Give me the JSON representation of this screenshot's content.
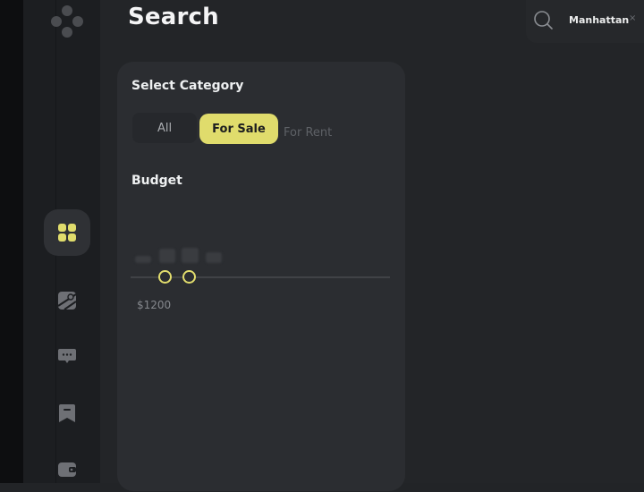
{
  "page": {
    "title": "Search"
  },
  "search": {
    "chip_label": "Manhattan",
    "chip_close": "×"
  },
  "filters": {
    "category_title": "Select Category",
    "categories": [
      "All",
      "For Sale",
      "For Rent"
    ],
    "selected_category": "For Sale",
    "budget_title": "Budget",
    "budget_min_label": "$1200"
  },
  "sidebar": {
    "items": [
      {
        "icon": "grid-icon",
        "active": true
      },
      {
        "icon": "map-icon",
        "active": false
      },
      {
        "icon": "chat-icon",
        "active": false
      },
      {
        "icon": "bookmark-icon",
        "active": false
      },
      {
        "icon": "wallet-icon",
        "active": false
      }
    ]
  },
  "colors": {
    "accent": "#e0dc6c",
    "background": "#222427",
    "panel": "#2b2d31"
  }
}
